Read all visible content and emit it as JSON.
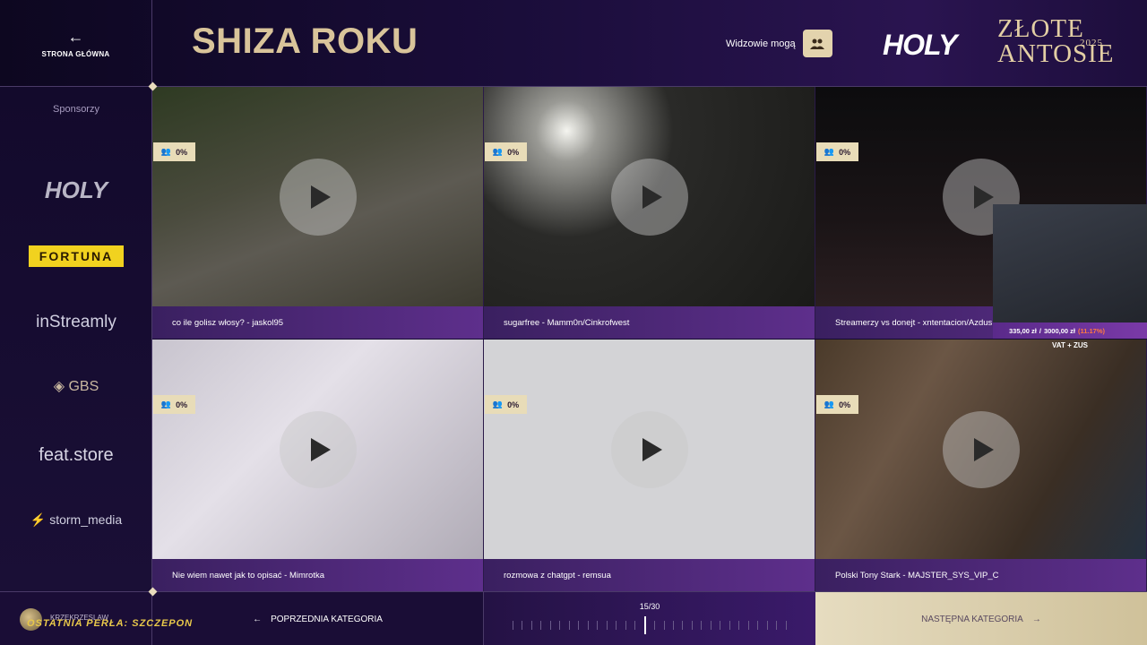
{
  "header": {
    "home_label": "STRONA GŁÓWNA",
    "title": "SHIZA ROKU",
    "viewers_label": "Widzowie mogą",
    "logo_text": "HOLY",
    "award_line1": "ZŁOTE",
    "award_line2": "ANTOSIE",
    "award_year": "2025"
  },
  "sidebar": {
    "label": "Sponsorzy",
    "sponsors": [
      "HOLY",
      "FORTUNA",
      "inStreamly",
      "GBS",
      "feat.store",
      "storm_media"
    ]
  },
  "cards": [
    {
      "title": "co ile golisz włosy? - jaskol95",
      "percent": "0%"
    },
    {
      "title": "sugarfree - Mamm0n/Cinkrofwest",
      "percent": "0%"
    },
    {
      "title": "Streamerzy vs donejt - xntentacion/Azdus",
      "percent": "0%"
    },
    {
      "title": "Nie wiem nawet jak to opisać - Mimrotka",
      "percent": "0%"
    },
    {
      "title": "rozmowa z chatgpt - remsua",
      "percent": "0%"
    },
    {
      "title": "Polski Tony Stark - MAJSTER_SYS_VIP_C",
      "percent": "0%"
    }
  ],
  "overlay": {
    "amount": "335,00 zł",
    "separator": "/",
    "goal": "3000,00 zł",
    "goal_percent": "(11.17%)",
    "vat": "VAT + ZUS"
  },
  "footer": {
    "username": "KRZEKRZESLAW",
    "pearl": "OSTATNIA PERŁA: SZCZEPON",
    "prev_label": "POPRZEDNIA KATEGORIA",
    "counter": "15/30",
    "current": 15,
    "total": 30,
    "next_label": "NASTĘPNA KATEGORIA"
  },
  "colors": {
    "accent_gold": "#d9c49a",
    "caption_purple": "#5e2f8c",
    "fortuna_yellow": "#f1d21f"
  }
}
